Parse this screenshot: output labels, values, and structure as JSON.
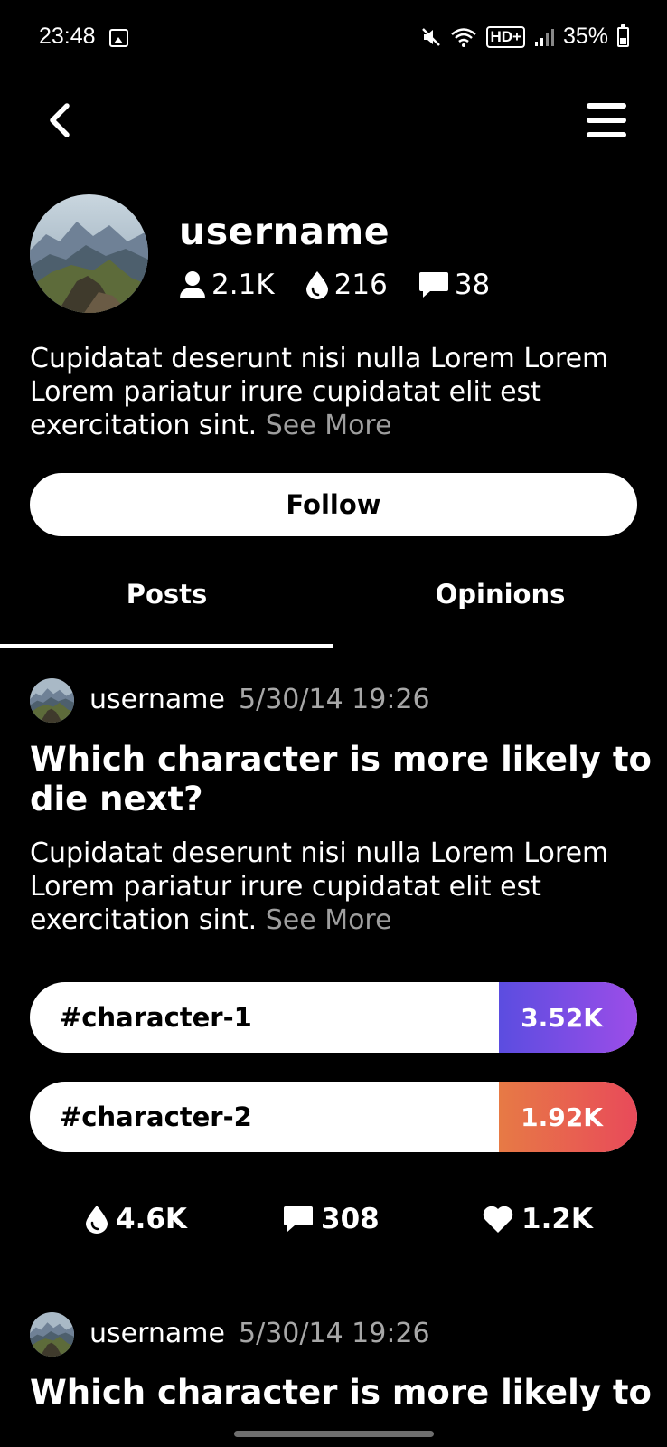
{
  "status_bar": {
    "time": "23:48",
    "battery": "35%",
    "network_label": "HD+",
    "icons": [
      "gallery-icon",
      "mute-icon",
      "wifi-icon",
      "hd-call-icon",
      "signal-icon",
      "battery-icon"
    ],
    "battery_level": 0.35
  },
  "header": {
    "back_icon": "chevron-left-icon",
    "menu_icon": "hamburger-menu-icon"
  },
  "profile": {
    "name": "username",
    "stats": {
      "followers": "2.1K",
      "drops": "216",
      "comments": "38"
    },
    "bio": "Cupidatat deserunt nisi nulla Lorem Lorem Lorem pariatur irure cupidatat elit est exercitation sint.",
    "see_more": "See More",
    "follow_label": "Follow"
  },
  "tabs": [
    {
      "label": "Posts",
      "active": true
    },
    {
      "label": "Opinions",
      "active": false
    }
  ],
  "posts": [
    {
      "author": "username",
      "time": "5/30/14 19:26",
      "title": "Which character is more likely to die next?",
      "body": "Cupidatat deserunt nisi nulla Lorem Lorem Lorem pariatur irure cupidatat elit est exercitation sint.",
      "see_more": "See More",
      "options": [
        {
          "label": "#character-1",
          "count": "3.52K",
          "color": "#7b4de4"
        },
        {
          "label": "#character-2",
          "count": "1.92K",
          "color": "#e8604f"
        }
      ],
      "actions": {
        "drops": "4.6K",
        "comments": "308",
        "likes": "1.2K"
      }
    },
    {
      "author": "username",
      "time": "5/30/14 19:26",
      "title": "Which character is more likely to"
    }
  ],
  "colors": {
    "background": "#000000",
    "text": "#ffffff",
    "muted": "#a7a7a7",
    "option1_gradient": [
      "#5b4de0",
      "#9c4de8"
    ],
    "option2_gradient": [
      "#e77a45",
      "#e84a5a"
    ]
  }
}
